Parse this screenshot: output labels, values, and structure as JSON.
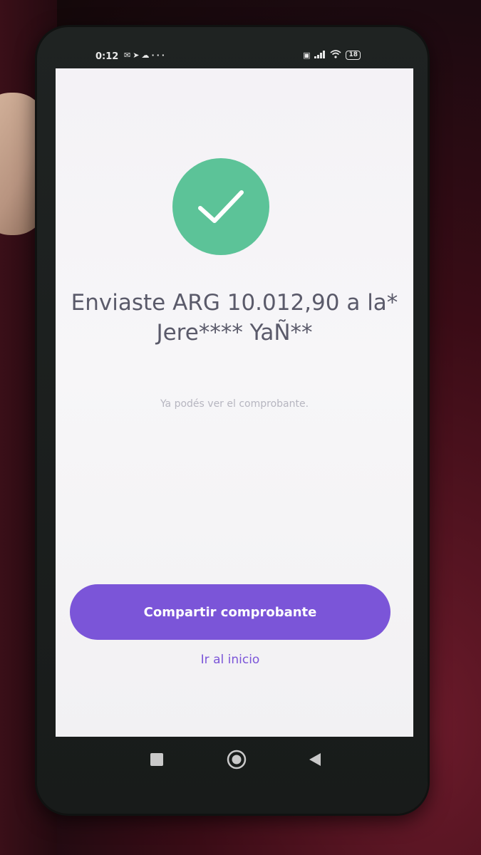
{
  "status_bar": {
    "time": "0:12",
    "left_icons": [
      "mail-icon",
      "play-icon",
      "cloud-icon",
      "more-icon"
    ],
    "right_icons": [
      "sim-icon",
      "signal-icon",
      "wifi-icon"
    ],
    "battery": "18"
  },
  "confirmation": {
    "icon": "check-icon",
    "accent_color": "#5cc398",
    "headline": "Enviaste ARG 10.012,90 a la* Jere**** YaÑ**",
    "subtext": "Ya podés ver el comprobante."
  },
  "actions": {
    "share_label": "Compartir comprobante",
    "home_label": "Ir al inicio",
    "button_color": "#7b55d8"
  },
  "navigation": {
    "icons": [
      "recents-icon",
      "home-icon",
      "back-icon"
    ]
  }
}
